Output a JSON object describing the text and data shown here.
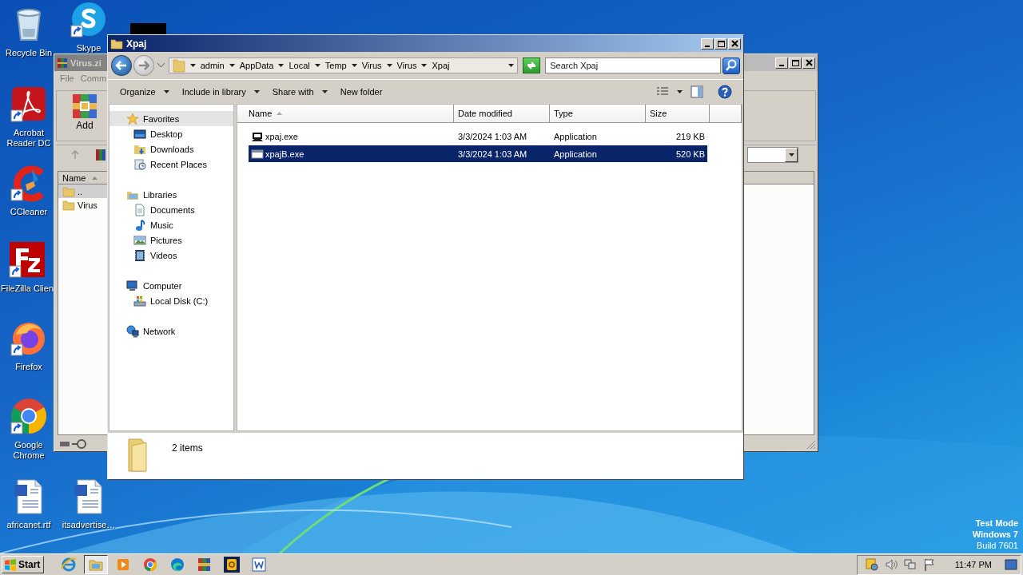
{
  "desktop": {
    "icons": [
      {
        "label": "Recycle Bin",
        "kind": "recycle",
        "shortcut": false
      },
      {
        "label": "Skype",
        "kind": "skype",
        "shortcut": true
      },
      {
        "label": "Acrobat Reader DC",
        "kind": "acrobat",
        "shortcut": true
      },
      {
        "label": "CCleaner",
        "kind": "ccleaner",
        "shortcut": true
      },
      {
        "label": "FileZilla Clien",
        "kind": "filezilla",
        "shortcut": true
      },
      {
        "label": "Firefox",
        "kind": "firefox",
        "shortcut": true
      },
      {
        "label": "Google Chrome",
        "kind": "chrome",
        "shortcut": true
      },
      {
        "label": "africanet.rtf",
        "kind": "word-doc",
        "shortcut": false
      },
      {
        "label": "itsadvertise…",
        "kind": "word-doc",
        "shortcut": false
      }
    ]
  },
  "archive_window": {
    "title": "Virus.zi",
    "menu": [
      "File",
      "Comm"
    ],
    "toolbar": [
      {
        "label": "Add"
      }
    ],
    "columns": [
      {
        "label": "Name",
        "sorted": true
      }
    ],
    "rows": [
      {
        "name": "..",
        "selected": true
      },
      {
        "name": "Virus",
        "selected": false
      }
    ]
  },
  "explorer": {
    "title": "Xpaj",
    "breadcrumb": [
      "admin",
      "AppData",
      "Local",
      "Temp",
      "Virus",
      "Virus",
      "Xpaj"
    ],
    "search": {
      "placeholder": "Search Xpaj"
    },
    "toolbar": [
      {
        "label": "Organize",
        "dropdown": true
      },
      {
        "label": "Include in library",
        "dropdown": true
      },
      {
        "label": "Share with",
        "dropdown": true
      },
      {
        "label": "New folder",
        "dropdown": false
      }
    ],
    "nav": [
      {
        "label": "Favorites",
        "selected": true,
        "children": [
          {
            "label": "Desktop",
            "selected": false
          },
          {
            "label": "Downloads",
            "selected": false
          },
          {
            "label": "Recent Places",
            "selected": false
          }
        ]
      },
      {
        "label": "Libraries",
        "selected": false,
        "children": [
          {
            "label": "Documents",
            "selected": false
          },
          {
            "label": "Music",
            "selected": false
          },
          {
            "label": "Pictures",
            "selected": false
          },
          {
            "label": "Videos",
            "selected": false
          }
        ]
      },
      {
        "label": "Computer",
        "selected": false,
        "children": [
          {
            "label": "Local Disk (C:)",
            "selected": false
          }
        ]
      },
      {
        "label": "Network",
        "selected": false
      }
    ],
    "columns": [
      {
        "label": "Name",
        "sorted": true
      },
      {
        "label": "Date modified",
        "sorted": false
      },
      {
        "label": "Type",
        "sorted": false
      },
      {
        "label": "Size",
        "sorted": false
      }
    ],
    "files": [
      {
        "name": "xpaj.exe",
        "date": "3/3/2024 1:03 AM",
        "type": "Application",
        "size": "219 KB",
        "selected": false
      },
      {
        "name": "xpajB.exe",
        "date": "3/3/2024 1:03 AM",
        "type": "Application",
        "size": "520 KB",
        "selected": true
      }
    ],
    "status": "2 items"
  },
  "taskbar": {
    "start": "Start",
    "apps": [
      {
        "kind": "ie",
        "selected": false
      },
      {
        "kind": "explorer",
        "selected": true
      },
      {
        "kind": "media",
        "selected": false
      },
      {
        "kind": "chrome",
        "selected": false
      },
      {
        "kind": "edge",
        "selected": false
      },
      {
        "kind": "winrar",
        "selected": false
      },
      {
        "kind": "notes",
        "selected": false
      },
      {
        "kind": "word",
        "selected": false
      }
    ],
    "tray": {
      "time": "11:47 PM"
    }
  },
  "system_notice": [
    "Test Mode",
    "Windows 7",
    "Build 7601"
  ]
}
